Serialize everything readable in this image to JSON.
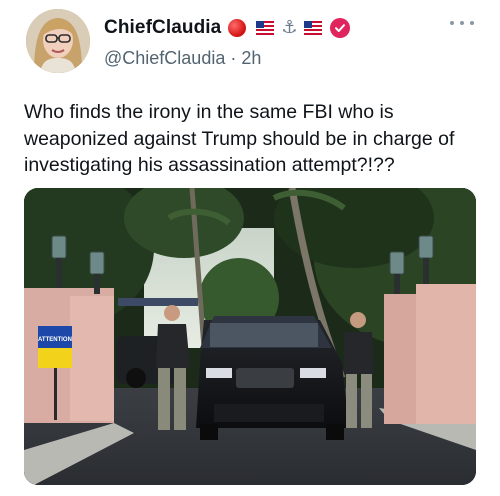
{
  "user": {
    "display_name": "ChiefClaudia",
    "handle": "@ChiefClaudia",
    "separator": "·",
    "time": "2h",
    "verified_color": "#e0245e"
  },
  "icons": [
    "red-circle-emoji",
    "us-flag-emoji",
    "anchor-emoji",
    "us-flag-emoji",
    "verified-badge-icon",
    "more-options-icon"
  ],
  "emoji": {
    "anchor": "⚓"
  },
  "tweet": {
    "text": "Who finds the irony in the same FBI who is weaponized against Trump should be in charge of investigating his assassination attempt?!??"
  },
  "media": {
    "sign_title": "ATTENTION",
    "vehicle_plate": ""
  }
}
